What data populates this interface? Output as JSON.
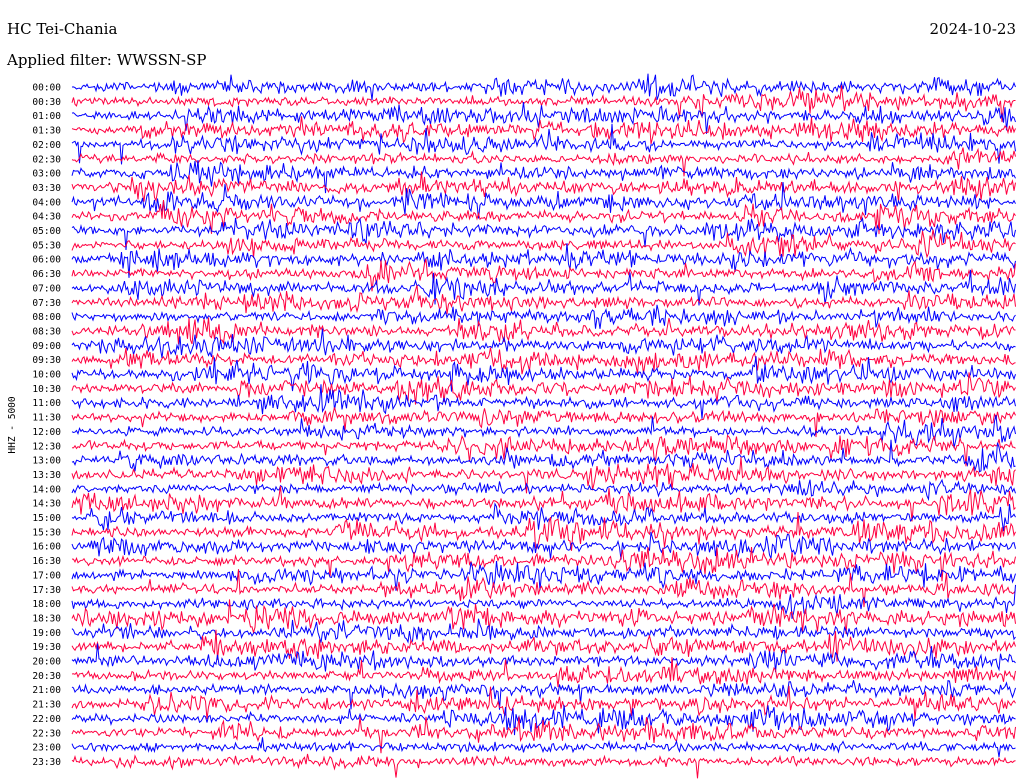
{
  "header": {
    "station": "HC Tei-Chania",
    "date": "2024-10-23",
    "filter_label": "Applied filter:",
    "filter_value": "WWSSN-SP"
  },
  "chart_data": {
    "type": "line",
    "subtype": "helicorder",
    "title": "HC Tei-Chania",
    "date": "2024-10-23",
    "filter": "WWSSN-SP",
    "ylabel": "HHZ - 5000",
    "xlabel": "",
    "row_minutes": 30,
    "row_labels": [
      "00:00",
      "00:30",
      "01:00",
      "01:30",
      "02:00",
      "02:30",
      "03:00",
      "03:30",
      "04:00",
      "04:30",
      "05:00",
      "05:30",
      "06:00",
      "06:30",
      "07:00",
      "07:30",
      "08:00",
      "08:30",
      "09:00",
      "09:30",
      "10:00",
      "10:30",
      "11:00",
      "11:30",
      "12:00",
      "12:30",
      "13:00",
      "13:30",
      "14:00",
      "14:30",
      "15:00",
      "15:30",
      "16:00",
      "16:30",
      "17:00",
      "17:30",
      "18:00",
      "18:30",
      "19:00",
      "19:30",
      "20:00",
      "20:30",
      "21:00",
      "21:30",
      "22:00",
      "22:30",
      "23:00",
      "23:30"
    ],
    "trace_colors": [
      "#0000ff",
      "#ff0040"
    ],
    "grid": false,
    "legend": "none"
  }
}
